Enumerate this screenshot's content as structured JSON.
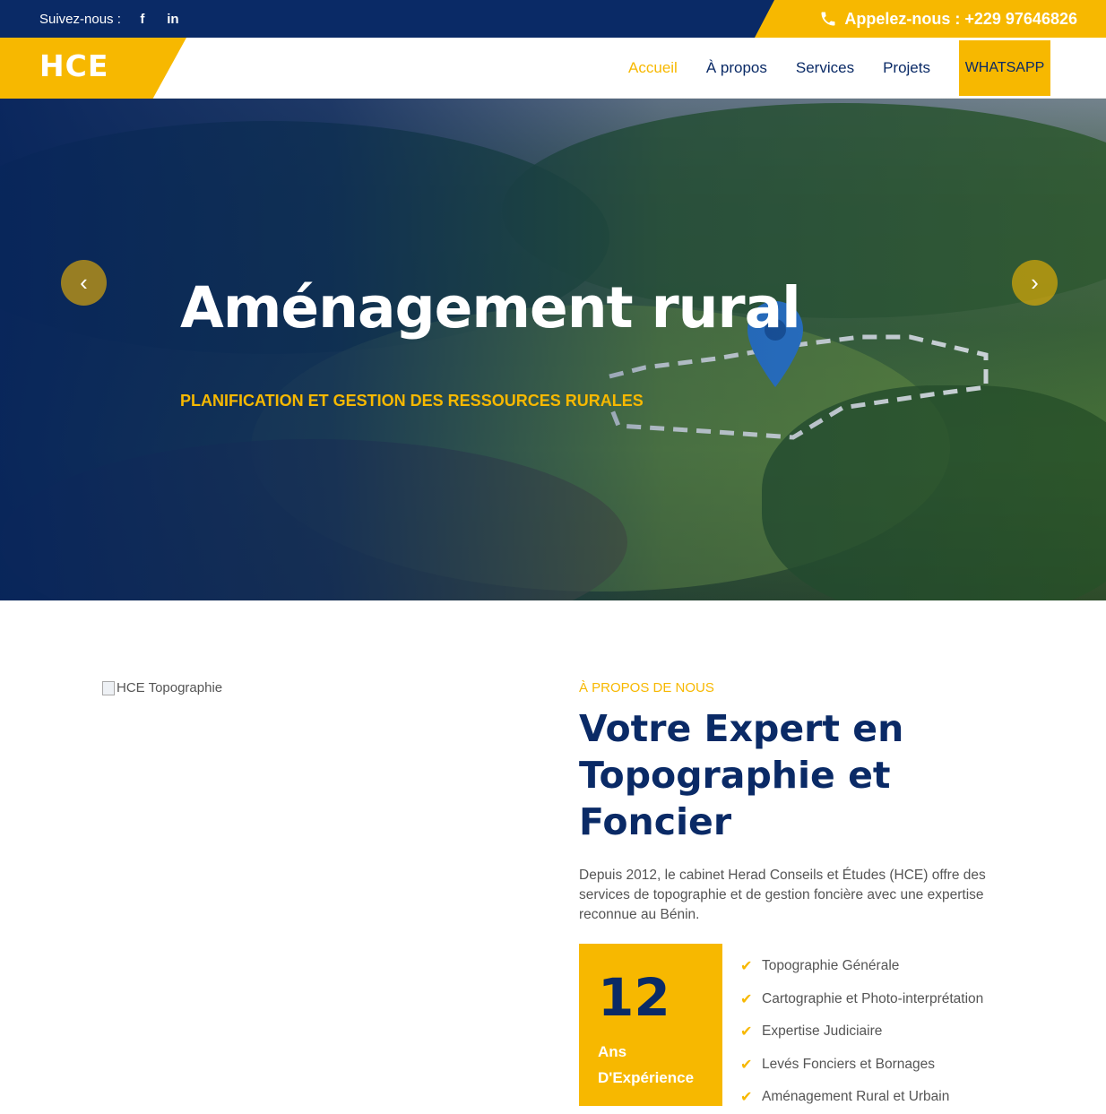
{
  "topbar": {
    "follow_label": "Suivez-nous :",
    "social": [
      {
        "icon": "facebook-icon",
        "glyph": "f"
      },
      {
        "icon": "linkedin-icon",
        "glyph": "in"
      }
    ],
    "call_label": "Appelez-nous : +229 97646826",
    "call_icon": "phone-icon"
  },
  "navbar": {
    "logo": "HCE",
    "links": [
      "Accueil",
      "À propos",
      "Services",
      "Projets"
    ],
    "active": "Accueil",
    "whatsapp": "WHATSAPP"
  },
  "hero": {
    "title": "Aménagement rural",
    "subtitle": "PLANIFICATION ET GESTION DES RESSOURCES RURALES",
    "prev_glyph": "‹",
    "next_glyph": "›"
  },
  "about": {
    "image_alt": "HCE Topographie",
    "label": "À PROPOS DE NOUS",
    "title": "Votre Expert en Topographie et Foncier",
    "text": "Depuis 2012, le cabinet Herad Conseils et Études (HCE) offre des services de topographie et de gestion foncière avec une expertise reconnue au Bénin.",
    "experience_number": "12",
    "experience_label": "Ans D'Expérience",
    "services": [
      "Topographie Générale",
      "Cartographie et Photo-interprétation",
      "Expertise Judiciaire",
      "Levés Fonciers et Bornages",
      "Aménagement Rural et Urbain"
    ]
  },
  "colors": {
    "navy": "#0a2a66",
    "yellow": "#f7b800"
  }
}
